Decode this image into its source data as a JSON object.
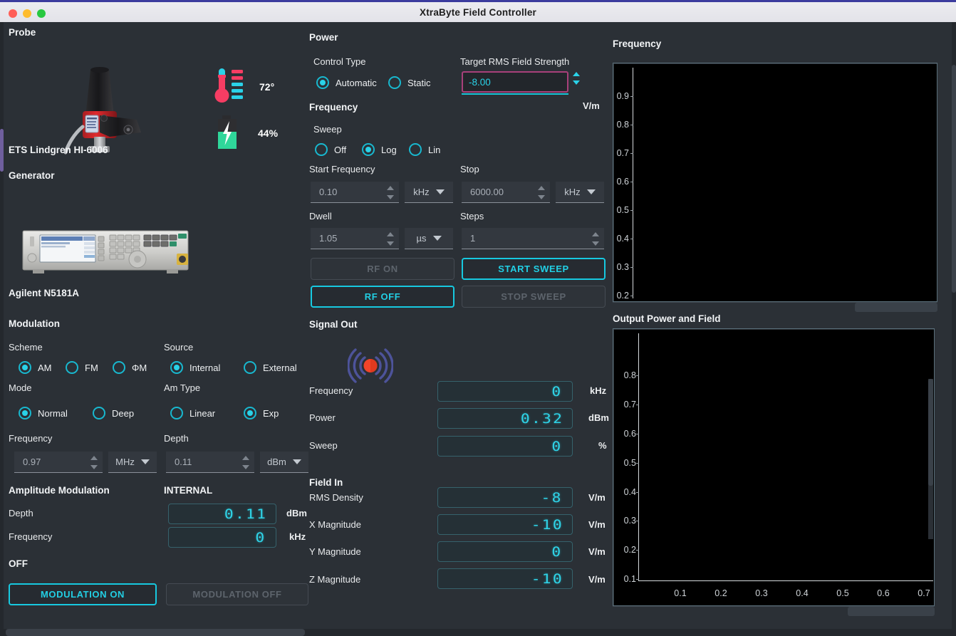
{
  "window": {
    "title": "XtraByte Field Controller",
    "controls": [
      "close",
      "minimize",
      "zoom"
    ]
  },
  "probe": {
    "group_title": "Probe",
    "model": "ETS Lindgren HI-6006",
    "temperature": "72°",
    "battery": "44%",
    "temp_icon": "thermometer-icon",
    "battery_icon": "battery-charging-icon",
    "probe_image": "field-probe-photo"
  },
  "generator": {
    "group_title": "Generator",
    "model": "Agilent N5181A",
    "generator_image": "signal-generator-photo"
  },
  "modulation": {
    "group_title": "Modulation",
    "scheme_label": "Scheme",
    "scheme_options": [
      {
        "label": "AM",
        "selected": true
      },
      {
        "label": "FM",
        "selected": false
      },
      {
        "label": "ΦM",
        "selected": false
      }
    ],
    "source_label": "Source",
    "source_options": [
      {
        "label": "Internal",
        "selected": true
      },
      {
        "label": "External",
        "selected": false
      }
    ],
    "mode_label": "Mode",
    "mode_options": [
      {
        "label": "Normal",
        "selected": true
      },
      {
        "label": "Deep",
        "selected": false
      }
    ],
    "am_type_label": "Am Type",
    "am_type_options": [
      {
        "label": "Linear",
        "selected": false
      },
      {
        "label": "Exp",
        "selected": true
      }
    ],
    "frequency_label": "Frequency",
    "frequency_value": "0.97",
    "frequency_unit": "MHz",
    "depth_label": "Depth",
    "depth_value": "0.11",
    "depth_unit": "dBm"
  },
  "amplitude_modulation": {
    "group_title": "Amplitude Modulation",
    "source_title": "INTERNAL",
    "depth_label": "Depth",
    "depth_value": "0.11",
    "depth_unit": "dBm",
    "frequency_label": "Frequency",
    "frequency_value": "0",
    "frequency_unit": "kHz",
    "status": "OFF",
    "on_button": "MODULATION ON",
    "off_button": "MODULATION OFF"
  },
  "power": {
    "group_title": "Power",
    "control_type_label": "Control Type",
    "control_type_options": [
      {
        "label": "Automatic",
        "selected": true
      },
      {
        "label": "Static",
        "selected": false
      }
    ],
    "target_label": "Target RMS Field Strength",
    "target_value": "-8.00",
    "target_unit": "V/m"
  },
  "frequency_panel": {
    "group_title": "Frequency",
    "sweep_label": "Sweep",
    "sweep_options": [
      {
        "label": "Off",
        "selected": false
      },
      {
        "label": "Log",
        "selected": true
      },
      {
        "label": "Lin",
        "selected": false
      }
    ],
    "start_label": "Start Frequency",
    "start_value": "0.10",
    "start_unit": "kHz",
    "stop_label": "Stop",
    "stop_value": "6000.00",
    "stop_unit": "kHz",
    "dwell_label": "Dwell",
    "dwell_value": "1.05",
    "dwell_unit": "µs",
    "steps_label": "Steps",
    "steps_value": "1",
    "rf_on_button": "RF ON",
    "rf_off_button": "RF OFF",
    "start_sweep_button": "START SWEEP",
    "stop_sweep_button": "STOP SWEEP"
  },
  "signal_out": {
    "group_title": "Signal Out",
    "icon": "broadcast-signal-icon",
    "rows": [
      {
        "label": "Frequency",
        "value": "0",
        "unit": "kHz"
      },
      {
        "label": "Power",
        "value": "0.32",
        "unit": "dBm"
      },
      {
        "label": "Sweep",
        "value": "0",
        "unit": "%"
      }
    ]
  },
  "field_in": {
    "group_title": "Field In",
    "rows": [
      {
        "label": "RMS Density",
        "value": "-8",
        "unit": "V/m"
      },
      {
        "label": "X Magnitude",
        "value": "-10",
        "unit": "V/m"
      },
      {
        "label": "Y Magnitude",
        "value": "0",
        "unit": "V/m"
      },
      {
        "label": "Z Magnitude",
        "value": "-10",
        "unit": "V/m"
      }
    ]
  },
  "chart_data": [
    {
      "type": "line",
      "title": "Frequency",
      "xlabel": "",
      "ylabel": "",
      "series": [],
      "yticks": [
        "0.9",
        "0.8",
        "0.7",
        "0.6",
        "0.5",
        "0.4",
        "0.3",
        "0.2"
      ],
      "xticks": [],
      "ylim": [
        0.15,
        0.95
      ],
      "grid": false,
      "legend": "none",
      "background": "#000000"
    },
    {
      "type": "line",
      "title": "Output Power and Field",
      "xlabel": "",
      "ylabel": "",
      "series": [],
      "yticks": [
        "0.8",
        "0.7",
        "0.6",
        "0.5",
        "0.4",
        "0.3",
        "0.2",
        "0.1"
      ],
      "xticks": [
        "0.1",
        "0.2",
        "0.3",
        "0.4",
        "0.5",
        "0.6",
        "0.7"
      ],
      "ylim": [
        0.05,
        0.85
      ],
      "xlim": [
        0.0,
        0.75
      ],
      "grid": false,
      "legend": "none",
      "background": "#000000"
    }
  ],
  "colors": {
    "accent_cyan": "#2ad2e8",
    "error_pink": "#a8407a",
    "panel_bg": "#2b3036",
    "plot_bg": "#000000",
    "battery_green": "#2fd69a",
    "temp_pink": "#f63d63"
  }
}
